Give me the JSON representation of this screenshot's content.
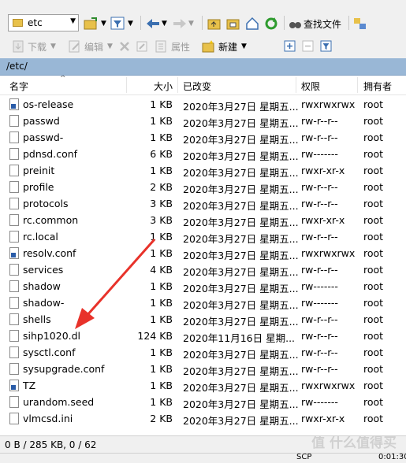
{
  "toolbar": {
    "path_combo": "etc",
    "find_files": "查找文件",
    "download": "下载",
    "edit": "编辑",
    "properties": "属性",
    "new": "新建"
  },
  "path_bar": "/etc/",
  "columns": {
    "name": "名字",
    "size": "大小",
    "changed": "已改变",
    "rights": "权限",
    "owner": "拥有者"
  },
  "files": [
    {
      "name": "os-release",
      "size": "1 KB",
      "changed": "2020年3月27日 星期五...",
      "rights": "rwxrwxrwx",
      "owner": "root",
      "link": true
    },
    {
      "name": "passwd",
      "size": "1 KB",
      "changed": "2020年3月27日 星期五...",
      "rights": "rw-r--r--",
      "owner": "root",
      "link": false
    },
    {
      "name": "passwd-",
      "size": "1 KB",
      "changed": "2020年3月27日 星期五...",
      "rights": "rw-r--r--",
      "owner": "root",
      "link": false
    },
    {
      "name": "pdnsd.conf",
      "size": "6 KB",
      "changed": "2020年3月27日 星期五...",
      "rights": "rw-------",
      "owner": "root",
      "link": false
    },
    {
      "name": "preinit",
      "size": "1 KB",
      "changed": "2020年3月27日 星期五...",
      "rights": "rwxr-xr-x",
      "owner": "root",
      "link": false
    },
    {
      "name": "profile",
      "size": "2 KB",
      "changed": "2020年3月27日 星期五...",
      "rights": "rw-r--r--",
      "owner": "root",
      "link": false
    },
    {
      "name": "protocols",
      "size": "3 KB",
      "changed": "2020年3月27日 星期五...",
      "rights": "rw-r--r--",
      "owner": "root",
      "link": false
    },
    {
      "name": "rc.common",
      "size": "3 KB",
      "changed": "2020年3月27日 星期五...",
      "rights": "rwxr-xr-x",
      "owner": "root",
      "link": false
    },
    {
      "name": "rc.local",
      "size": "1 KB",
      "changed": "2020年3月27日 星期五...",
      "rights": "rw-r--r--",
      "owner": "root",
      "link": false
    },
    {
      "name": "resolv.conf",
      "size": "1 KB",
      "changed": "2020年3月27日 星期五...",
      "rights": "rwxrwxrwx",
      "owner": "root",
      "link": true
    },
    {
      "name": "services",
      "size": "4 KB",
      "changed": "2020年3月27日 星期五...",
      "rights": "rw-r--r--",
      "owner": "root",
      "link": false
    },
    {
      "name": "shadow",
      "size": "1 KB",
      "changed": "2020年3月27日 星期五...",
      "rights": "rw-------",
      "owner": "root",
      "link": false
    },
    {
      "name": "shadow-",
      "size": "1 KB",
      "changed": "2020年3月27日 星期五...",
      "rights": "rw-------",
      "owner": "root",
      "link": false
    },
    {
      "name": "shells",
      "size": "1 KB",
      "changed": "2020年3月27日 星期五...",
      "rights": "rw-r--r--",
      "owner": "root",
      "link": false
    },
    {
      "name": "sihp1020.dl",
      "size": "124 KB",
      "changed": "2020年11月16日 星期...",
      "rights": "rw-r--r--",
      "owner": "root",
      "link": false
    },
    {
      "name": "sysctl.conf",
      "size": "1 KB",
      "changed": "2020年3月27日 星期五...",
      "rights": "rw-r--r--",
      "owner": "root",
      "link": false
    },
    {
      "name": "sysupgrade.conf",
      "size": "1 KB",
      "changed": "2020年3月27日 星期五...",
      "rights": "rw-r--r--",
      "owner": "root",
      "link": false
    },
    {
      "name": "TZ",
      "size": "1 KB",
      "changed": "2020年3月27日 星期五...",
      "rights": "rwxrwxrwx",
      "owner": "root",
      "link": true
    },
    {
      "name": "urandom.seed",
      "size": "1 KB",
      "changed": "2020年3月27日 星期五...",
      "rights": "rw-------",
      "owner": "root",
      "link": false
    },
    {
      "name": "vlmcsd.ini",
      "size": "2 KB",
      "changed": "2020年3月27日 星期五...",
      "rights": "rwxr-xr-x",
      "owner": "root",
      "link": false
    }
  ],
  "status": "0 B / 285 KB,  0 / 62",
  "status2": {
    "protocol": "SCP",
    "time": "0:01:30"
  },
  "watermark": "值 什么值得买",
  "colors": {
    "path_bar": "#99b7d6",
    "arrow": "#e8322a"
  }
}
